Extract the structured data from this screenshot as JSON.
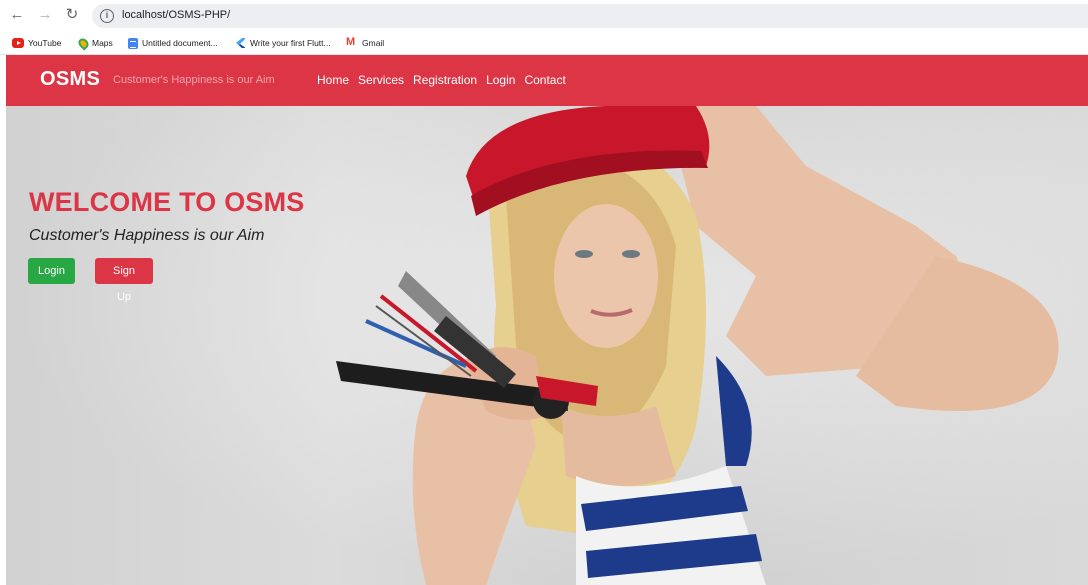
{
  "browser": {
    "url": "localhost/OSMS-PHP/",
    "bookmarks": [
      "YouTube",
      "Maps",
      "Untitled document...",
      "Write your first Flutt...",
      "Gmail"
    ]
  },
  "navbar": {
    "brand": "OSMS",
    "tagline": "Customer's Happiness is our Aim",
    "links": [
      "Home",
      "Services",
      "Registration",
      "Login",
      "Contact"
    ],
    "color": "#dc3545"
  },
  "hero": {
    "title": "WELCOME TO OSMS",
    "subtitle": "Customer's Happiness is our Aim",
    "login_label": "Login",
    "signup_label": "Sign Up"
  }
}
